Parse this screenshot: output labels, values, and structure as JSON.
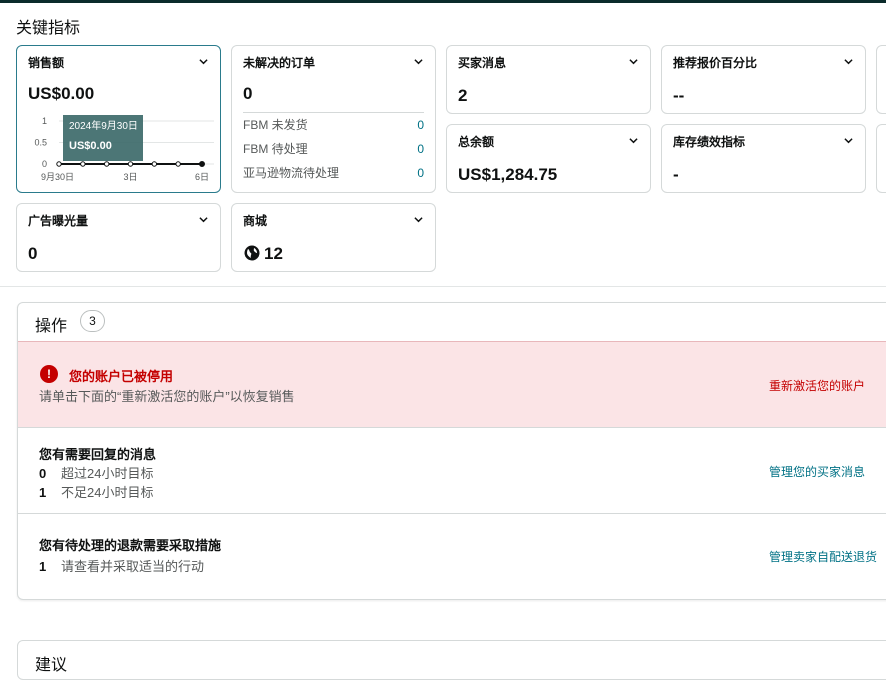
{
  "section_title": "关键指标",
  "cards": {
    "sales": {
      "title": "销售额",
      "value": "US$0.00"
    },
    "unresolved_orders": {
      "title": "未解决的订单",
      "value": "0",
      "rows": [
        {
          "label": "FBM 未发货",
          "value": "0"
        },
        {
          "label": "FBM 待处理",
          "value": "0"
        },
        {
          "label": "亚马逊物流待处理",
          "value": "0"
        }
      ]
    },
    "buyer_messages": {
      "title": "买家消息",
      "value": "2"
    },
    "featured_offer": {
      "title": "推荐报价百分比",
      "value": "--"
    },
    "total_balance": {
      "title": "总余额",
      "value": "US$1,284.75"
    },
    "inventory_performance": {
      "title": "库存绩效指标",
      "value": "-"
    },
    "ad_impressions": {
      "title": "广告曝光量",
      "value": "0"
    },
    "store": {
      "title": "商城",
      "value": "12"
    }
  },
  "chart_data": {
    "type": "line",
    "x": [
      "9月30日",
      "",
      "",
      "3日",
      "",
      "",
      "6日"
    ],
    "values": [
      0,
      0,
      0,
      0,
      0,
      0,
      0
    ],
    "yticks": [
      "1",
      "0.5",
      "0"
    ],
    "ylim": [
      0,
      1
    ],
    "tooltip": {
      "date": "2024年9月30日",
      "value": "US$0.00"
    },
    "colors": {
      "line": "#0f1111",
      "tooltip_bg": "#3d6a6a"
    }
  },
  "actions_panel": {
    "title": "操作",
    "count": "3",
    "items": [
      {
        "kind": "alert",
        "title": "您的账户已被停用",
        "text": "请单击下面的“重新激活您的账户”以恢复销售",
        "link": "重新激活您的账户"
      },
      {
        "kind": "messages",
        "title": "您有需要回复的消息",
        "lines": [
          {
            "count": "0",
            "label": "超过24小时目标"
          },
          {
            "count": "1",
            "label": "不足24小时目标"
          }
        ],
        "link": "管理您的买家消息"
      },
      {
        "kind": "refunds",
        "title": "您有待处理的退款需要采取措施",
        "lines": [
          {
            "count": "1",
            "label": "请查看并采取适当的行动"
          }
        ],
        "link": "管理卖家自配送退货"
      }
    ]
  },
  "suggestions_panel": {
    "title": "建议"
  },
  "colors": {
    "accent": "#007185",
    "alert": "#c40000",
    "alert_bg": "#fbe4e6",
    "active_border": "#2a7b8c"
  }
}
